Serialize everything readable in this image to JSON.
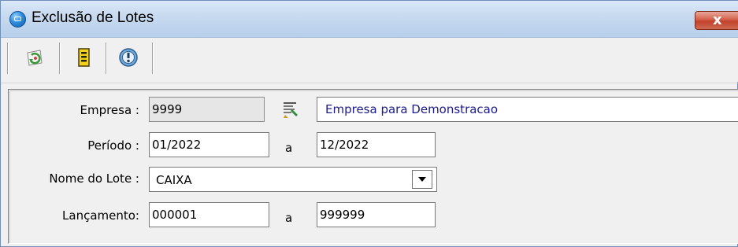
{
  "window": {
    "title": "Exclusão de Lotes",
    "close_symbol": "x"
  },
  "toolbar": {
    "buttons": [
      {
        "name": "refresh",
        "icon": "refresh-icon"
      },
      {
        "name": "execute",
        "icon": "document-list-icon"
      },
      {
        "name": "help",
        "icon": "info-icon"
      }
    ]
  },
  "form": {
    "empresa": {
      "label": "Empresa :",
      "code": "9999",
      "name": "Empresa para Demonstracao",
      "search_icon": "search-company-icon"
    },
    "periodo": {
      "label": "Período :",
      "from": "01/2022",
      "separator": "a",
      "to": "12/2022"
    },
    "nome_lote": {
      "label": "Nome do Lote :",
      "selected": "CAIXA"
    },
    "lancamento": {
      "label": "Lançamento:",
      "from": "000001",
      "separator": "a",
      "to": "999999"
    }
  },
  "colors": {
    "titlebar": "#c6d9ef",
    "close_button": "#c2412b",
    "company_name_text": "#1a1a8c"
  }
}
